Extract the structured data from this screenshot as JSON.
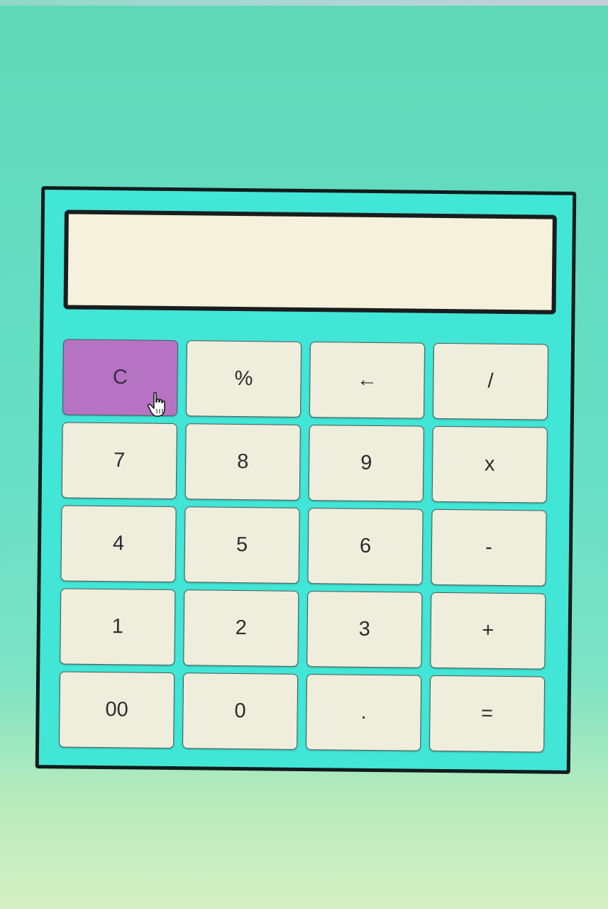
{
  "display": {
    "value": ""
  },
  "keys": [
    {
      "label": "C",
      "type": "clear"
    },
    {
      "label": "%"
    },
    {
      "label": "←"
    },
    {
      "label": "/"
    },
    {
      "label": "7"
    },
    {
      "label": "8"
    },
    {
      "label": "9"
    },
    {
      "label": "x"
    },
    {
      "label": "4"
    },
    {
      "label": "5"
    },
    {
      "label": "6"
    },
    {
      "label": "-"
    },
    {
      "label": "1"
    },
    {
      "label": "2"
    },
    {
      "label": "3"
    },
    {
      "label": "+"
    },
    {
      "label": "00"
    },
    {
      "label": "0"
    },
    {
      "label": "."
    },
    {
      "label": "="
    }
  ],
  "colors": {
    "background": "#63dcc0",
    "calculator_body": "#42e6d6",
    "display_bg": "#f6f1dc",
    "key_bg": "#efeedd",
    "clear_key_bg": "#b673c4",
    "border": "#121b1b"
  }
}
